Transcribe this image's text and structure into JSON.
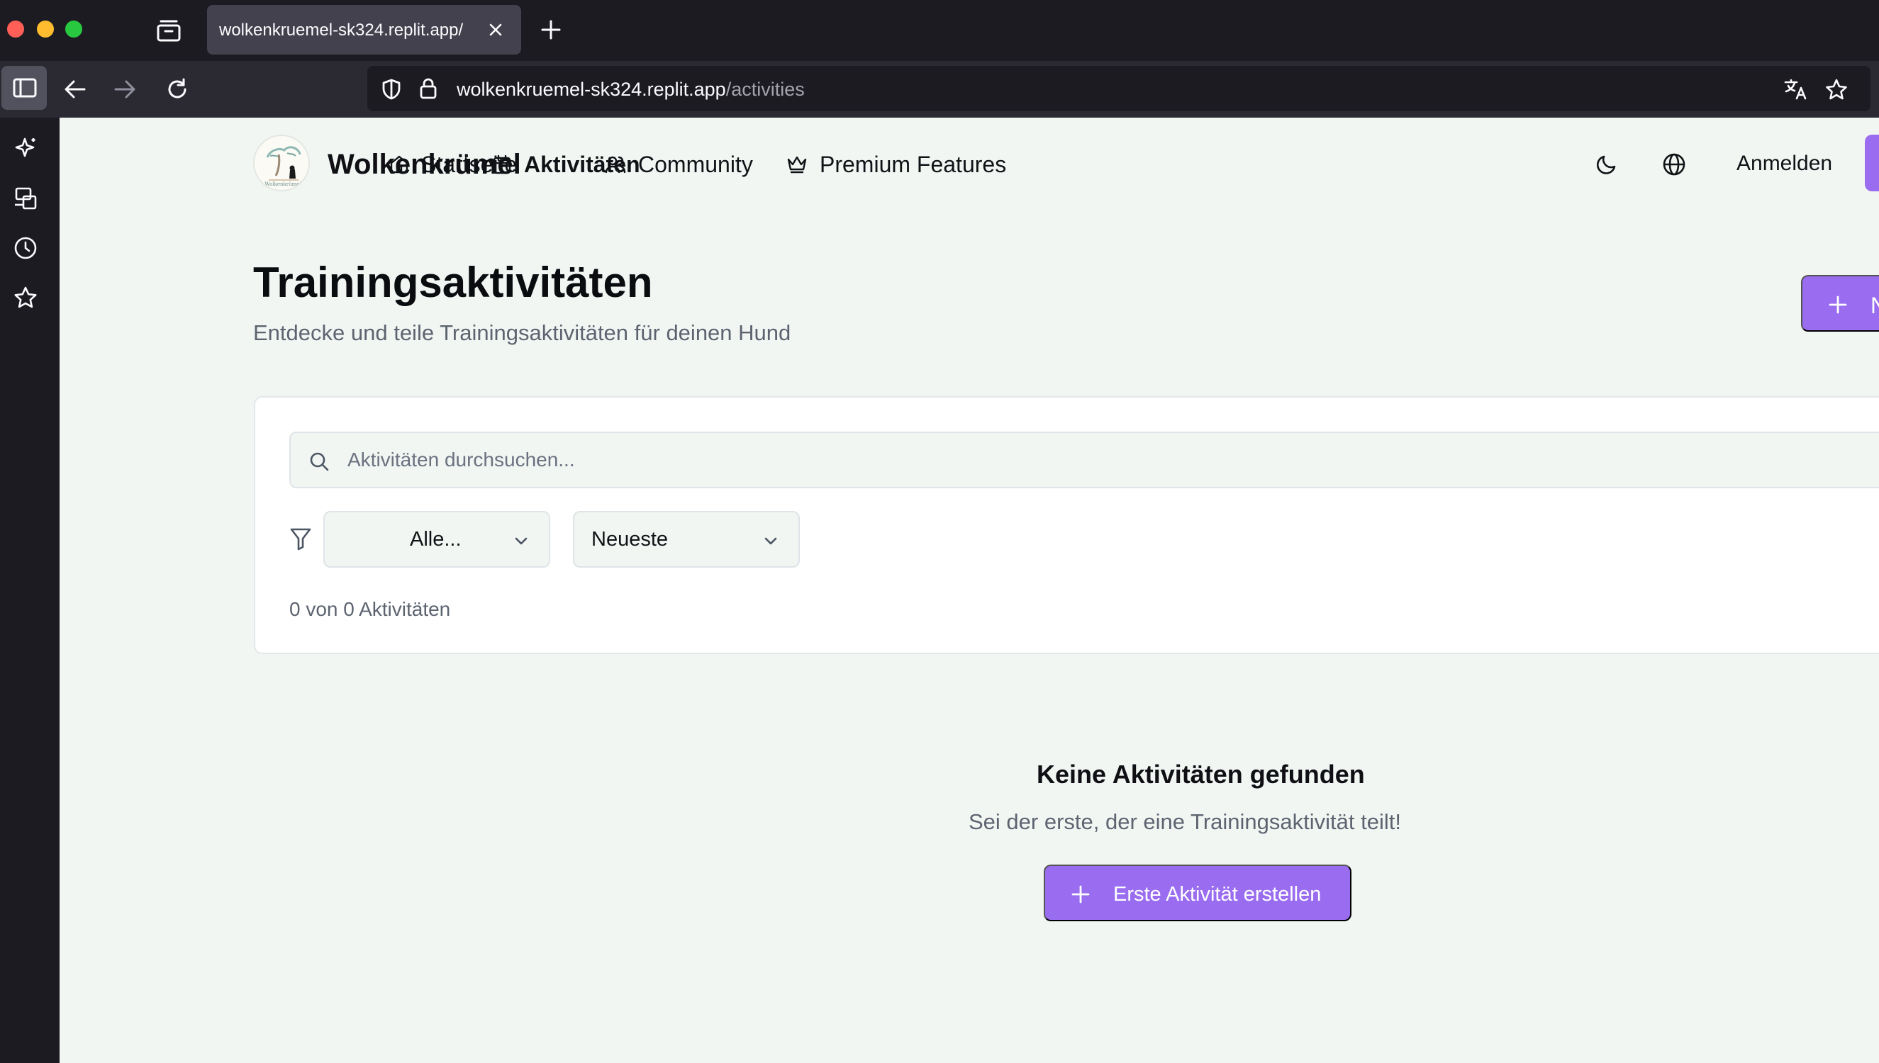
{
  "browser": {
    "tab_title": "wolkenkruemel-sk324.replit.app/",
    "url_host": "wolkenkruemel-sk324.replit.app",
    "url_path": "/activities"
  },
  "header": {
    "brand": "Wolkenkrümel",
    "logo_text": "Wolkenkrümel",
    "nav": [
      {
        "label": "Startseite",
        "icon": "home-icon"
      },
      {
        "label": "Aktivitäten",
        "icon": "calendar-icon",
        "active": true
      },
      {
        "label": "Community",
        "icon": "users-icon"
      },
      {
        "label": "Premium Features",
        "icon": "crown-icon"
      }
    ],
    "login_label": "Anmelden"
  },
  "main": {
    "title": "Trainingsaktivitäten",
    "subtitle": "Entdecke und teile Trainingsaktivitäten für deinen Hund",
    "new_button_label": "N"
  },
  "filters": {
    "search_placeholder": "Aktivitäten durchsuchen...",
    "category_value": "Alle...",
    "sort_value": "Neueste",
    "count_text": "0 von 0 Aktivitäten"
  },
  "empty_state": {
    "title": "Keine Aktivitäten gefunden",
    "subtitle": "Sei der erste, der eine Trainingsaktivität teilt!",
    "button_label": "Erste Aktivität erstellen"
  },
  "colors": {
    "accent": "#9a6cf0",
    "page_bg": "#f1f6f3",
    "chrome_bg": "#1c1b22"
  }
}
